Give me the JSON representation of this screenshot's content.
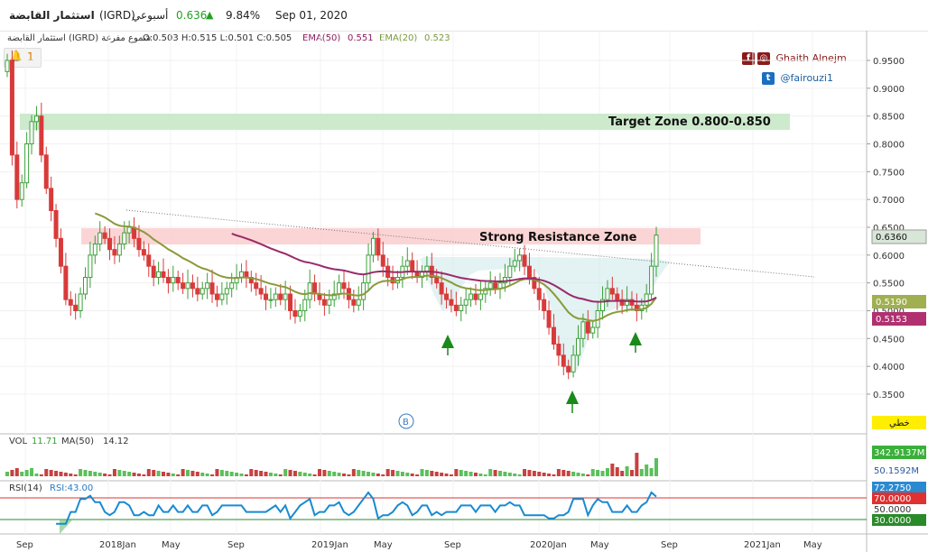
{
  "header": {
    "symbol_name": "استثمار القابضة",
    "ticker": "(IGRD)",
    "interval": "أسبوعي",
    "last_price": "0.636",
    "change_pct": "9.84%",
    "date": "Sep 01, 2020",
    "up_color": "#22a022"
  },
  "legend": {
    "symbol_info": "استثمار القابضة (IGRD) شموع مفرغة",
    "ohlc": "O:0.503 H:0.515 L:0.501 C:0.505",
    "ema50_label": "EMA(50)",
    "ema50_value": "0.551",
    "ema20_label": "EMA(20)",
    "ema20_value": "0.523",
    "alert_count": "1"
  },
  "social": {
    "name": "Ghaith Alnejm",
    "twitter": "@fairouzi1",
    "facebook_icon": "facebook-icon",
    "instagram_icon": "instagram-icon",
    "twitter_icon": "twitter-icon"
  },
  "annotations": {
    "target_zone": "Target Zone 0.800-0.850",
    "resistance_zone": "Strong Resistance Zone",
    "b_marker": "B",
    "line_type_button": "خطي"
  },
  "price_tags": {
    "last": "0.6360",
    "ema20": "0.5190",
    "ema50": "0.5153"
  },
  "volume_panel": {
    "label": "VOL",
    "vol_value": "11.71",
    "ma_label": "MA(50)",
    "ma_value": "14.12",
    "tag_volume": "342.9137M",
    "tag_ma": "50.1592M"
  },
  "rsi_panel": {
    "label": "RSI(14)",
    "value_label": "RSI:43.00",
    "tag_rsi": "72.2750",
    "tag_70": "70.0000",
    "tag_50": "50.0000",
    "tag_30": "30.0000"
  },
  "chart_data": {
    "type": "candlestick",
    "y_axis_ticks": [
      "0.9500",
      "0.9000",
      "0.8500",
      "0.8000",
      "0.7500",
      "0.7000",
      "0.6500",
      "0.6000",
      "0.5500",
      "0.5000",
      "0.4500",
      "0.4000",
      "0.3500"
    ],
    "x_axis_ticks": [
      "Sep",
      "2018Jan",
      "May",
      "Sep",
      "2019Jan",
      "May",
      "Sep",
      "2020Jan",
      "May",
      "Sep",
      "2021Jan",
      "May"
    ],
    "ylim": [
      0.31,
      0.98
    ],
    "target_zone": [
      0.83,
      0.855
    ],
    "resistance_zone": [
      0.62,
      0.65
    ],
    "close": [
      0.95,
      0.78,
      0.7,
      0.73,
      0.8,
      0.84,
      0.85,
      0.78,
      0.72,
      0.68,
      0.63,
      0.58,
      0.52,
      0.51,
      0.5,
      0.53,
      0.56,
      0.6,
      0.62,
      0.64,
      0.63,
      0.61,
      0.6,
      0.62,
      0.64,
      0.65,
      0.63,
      0.61,
      0.6,
      0.58,
      0.56,
      0.57,
      0.56,
      0.55,
      0.56,
      0.55,
      0.54,
      0.55,
      0.54,
      0.53,
      0.54,
      0.55,
      0.53,
      0.52,
      0.53,
      0.54,
      0.55,
      0.56,
      0.57,
      0.56,
      0.55,
      0.54,
      0.53,
      0.52,
      0.52,
      0.53,
      0.52,
      0.53,
      0.5,
      0.49,
      0.5,
      0.52,
      0.55,
      0.53,
      0.52,
      0.51,
      0.52,
      0.53,
      0.55,
      0.54,
      0.52,
      0.51,
      0.52,
      0.55,
      0.6,
      0.63,
      0.6,
      0.58,
      0.56,
      0.55,
      0.56,
      0.58,
      0.59,
      0.57,
      0.56,
      0.57,
      0.58,
      0.56,
      0.55,
      0.53,
      0.52,
      0.51,
      0.5,
      0.51,
      0.52,
      0.53,
      0.52,
      0.53,
      0.54,
      0.55,
      0.54,
      0.55,
      0.56,
      0.58,
      0.59,
      0.6,
      0.58,
      0.56,
      0.54,
      0.52,
      0.5,
      0.47,
      0.44,
      0.42,
      0.4,
      0.39,
      0.42,
      0.45,
      0.48,
      0.46,
      0.47,
      0.5,
      0.52,
      0.54,
      0.53,
      0.52,
      0.51,
      0.52,
      0.51,
      0.5,
      0.51,
      0.53,
      0.58,
      0.636
    ],
    "ema50": [
      0.64,
      0.64,
      0.64,
      0.64,
      0.64,
      0.64,
      0.63,
      0.63,
      0.63,
      0.62,
      0.62,
      0.62,
      0.61,
      0.61,
      0.61,
      0.6,
      0.6,
      0.6,
      0.6,
      0.59,
      0.59,
      0.59,
      0.58,
      0.58,
      0.58,
      0.58,
      0.57,
      0.57,
      0.57,
      0.57,
      0.57,
      0.57,
      0.56,
      0.56,
      0.56,
      0.56,
      0.56,
      0.56,
      0.56,
      0.56,
      0.56,
      0.56,
      0.56,
      0.56,
      0.56,
      0.56,
      0.56,
      0.56,
      0.56,
      0.56,
      0.55,
      0.55,
      0.55,
      0.55,
      0.55,
      0.55,
      0.54,
      0.54,
      0.54,
      0.54,
      0.54,
      0.54,
      0.54,
      0.54,
      0.54,
      0.54,
      0.53,
      0.53,
      0.53,
      0.53,
      0.52,
      0.52,
      0.52,
      0.52,
      0.52,
      0.52,
      0.52,
      0.52,
      0.52,
      0.52,
      0.52,
      0.52,
      0.515,
      0.515,
      0.515
    ],
    "ema50_start_index": 46,
    "ema20_start_index": 18,
    "volume_tags_note": "volume bars in millions",
    "volume_peak": 342.9137,
    "rsi_levels": [
      30,
      50,
      70
    ],
    "last_rsi": 72.275
  }
}
